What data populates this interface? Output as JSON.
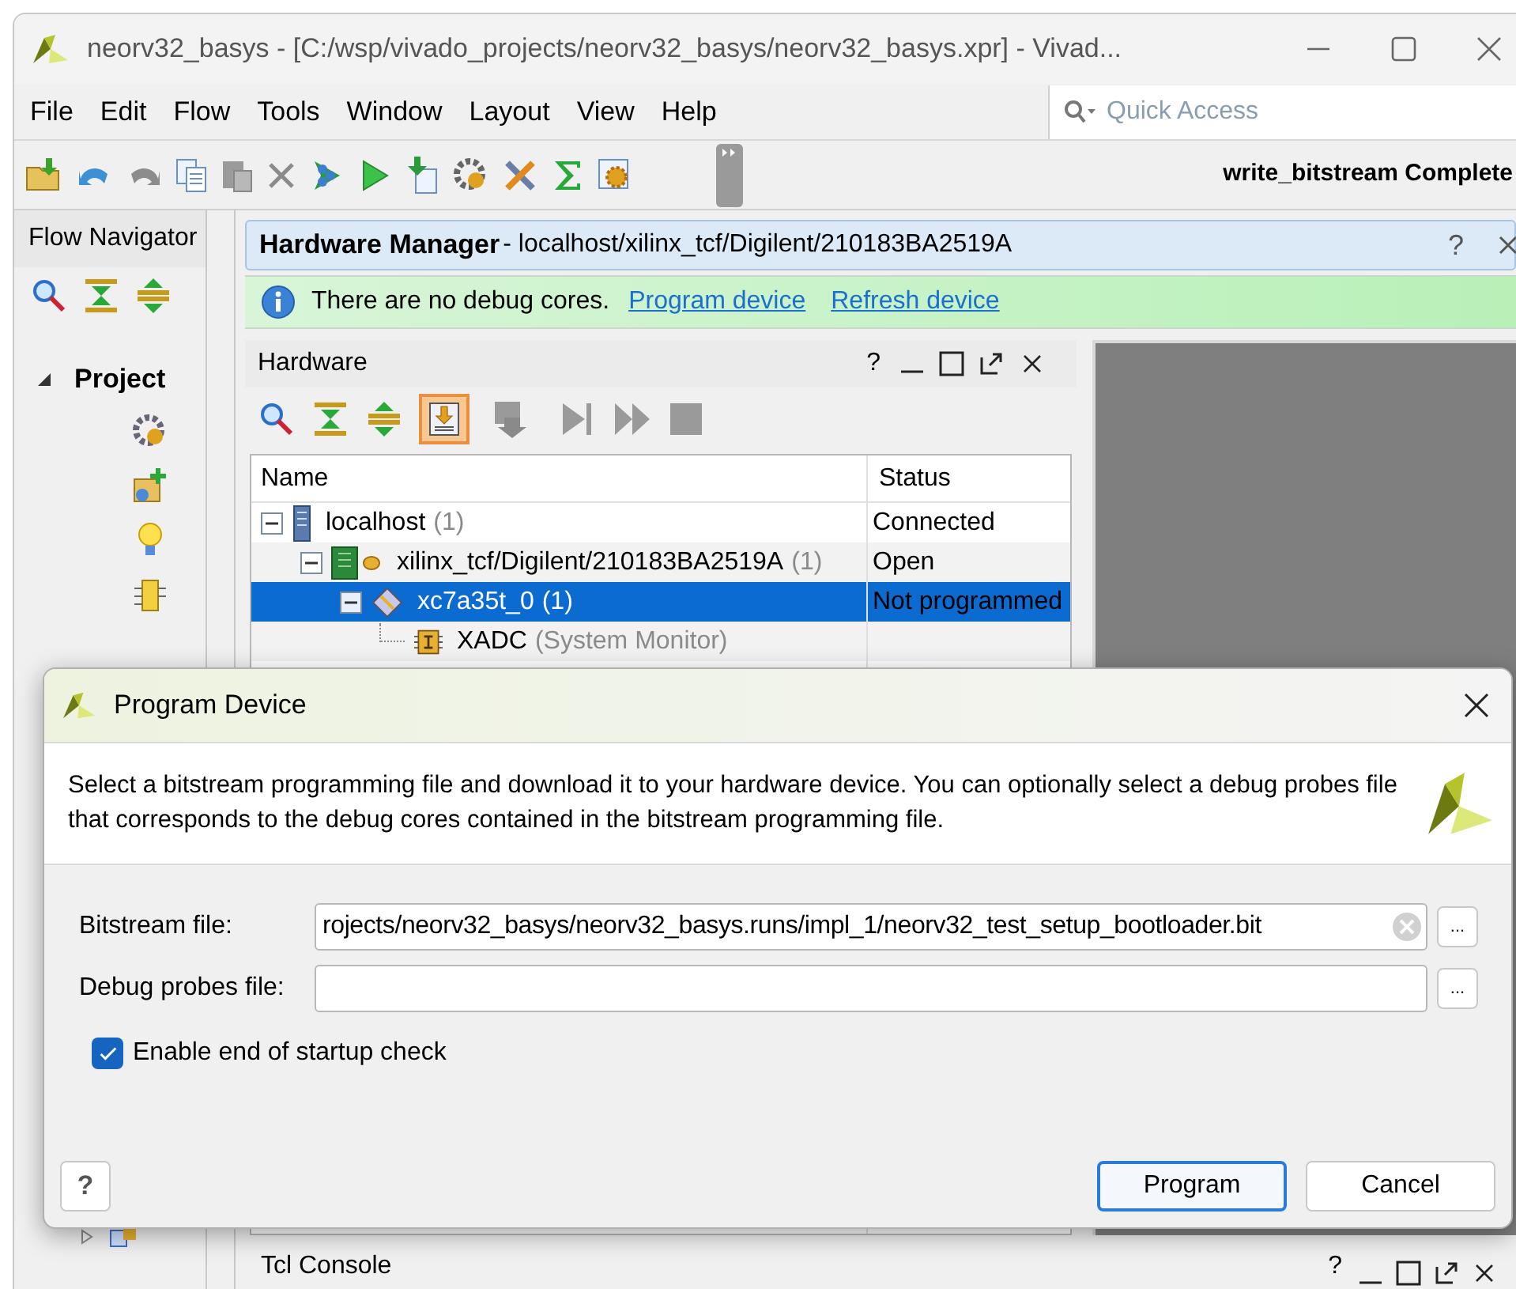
{
  "window": {
    "title": "neorv32_basys - [C:/wsp/vivado_projects/neorv32_basys/neorv32_basys.xpr] - Vivad..."
  },
  "menu": [
    "File",
    "Edit",
    "Flow",
    "Tools",
    "Window",
    "Layout",
    "View",
    "Help"
  ],
  "quick_access": {
    "placeholder": "Quick Access"
  },
  "status_text": "write_bitstream Complete",
  "flow_navigator": {
    "title": "Flow Navigator",
    "section": "Project",
    "expanded": true
  },
  "hardware_manager": {
    "title": "Hardware Manager",
    "path": " - localhost/xilinx_tcf/Digilent/210183BA2519A",
    "help": "?"
  },
  "info_bar": {
    "message": "There are no debug cores.",
    "links": [
      "Program device",
      "Refresh device"
    ]
  },
  "hardware_panel": {
    "title": "Hardware",
    "help": "?",
    "columns": [
      "Name",
      "Status"
    ],
    "rows": [
      {
        "kind": "host",
        "name": "localhost",
        "count": "(1)",
        "status": "Connected",
        "selected": false,
        "expanded": true,
        "children": [
          {
            "kind": "cable",
            "name": "xilinx_tcf/Digilent/210183BA2519A",
            "count": "(1)",
            "status": "Open",
            "selected": false,
            "expanded": true,
            "children": [
              {
                "kind": "device",
                "name": "xc7a35t_0",
                "count": "(1)",
                "status": "Not programmed",
                "selected": true,
                "expanded": true,
                "children": [
                  {
                    "kind": "monitor",
                    "name": "XADC",
                    "count": "(System Monitor)",
                    "selected": false
                  }
                ]
              }
            ]
          }
        ]
      }
    ]
  },
  "tcl_console": {
    "title": "Tcl Console",
    "help": "?"
  },
  "dialog": {
    "title": "Program Device",
    "description": "Select a bitstream programming file and download it to your hardware device. You can optionally select a debug probes file that corresponds to the debug cores contained in the bitstream programming file.",
    "fields": [
      {
        "label": "Bitstream file:",
        "value": "rojects/neorv32_basys/neorv32_basys.runs/impl_1/neorv32_test_setup_bootloader.bit",
        "browse": "..."
      },
      {
        "label": "Debug probes file:",
        "browse": "..."
      }
    ],
    "checkbox": {
      "label": "Enable end of startup check",
      "checked": true
    },
    "help": "?",
    "buttons": [
      {
        "label": "Program",
        "default": true
      },
      {
        "label": "Cancel",
        "default": false
      }
    ]
  }
}
